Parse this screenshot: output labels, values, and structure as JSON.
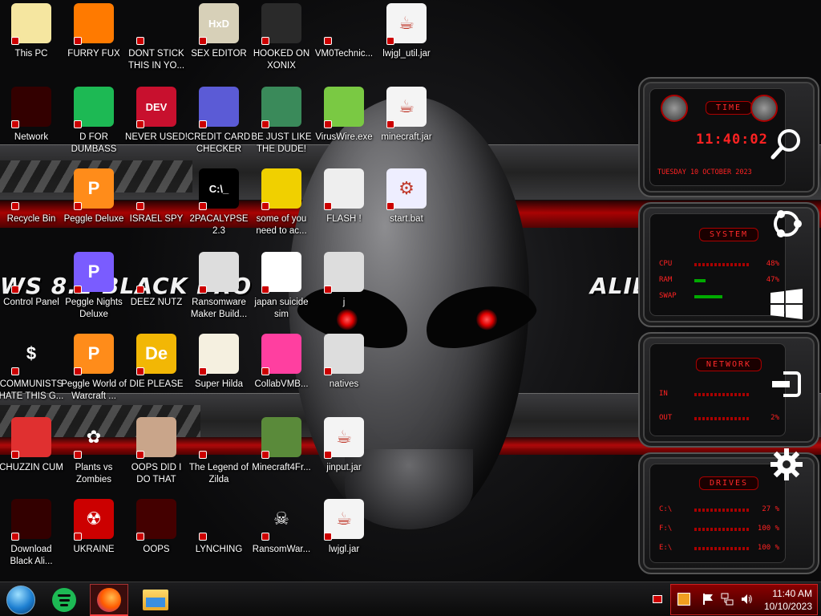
{
  "wallpaper": {
    "left_text": "WS 8.1 BLACK PRO",
    "right_text": "ALIE",
    "accent": "#e00000"
  },
  "desktop_icons": [
    {
      "label": "This PC",
      "icon": "anime-girl-icon",
      "bg": "#f5e6a0",
      "glyph": ""
    },
    {
      "label": "FURRY FUX",
      "icon": "firefox-icon",
      "bg": "#ff7a00",
      "glyph": ""
    },
    {
      "label": "DONT STICK THIS IN YO...",
      "icon": "vlc-cone-icon",
      "bg": "transparent",
      "glyph": ""
    },
    {
      "label": "SEX EDITOR",
      "icon": "hxd-icon",
      "bg": "#d7d0b8",
      "glyph": "HxD"
    },
    {
      "label": "HOOKED ON XONIX",
      "icon": "xonix-icon",
      "bg": "#2a2a2a",
      "glyph": ""
    },
    {
      "label": "VM0Technic...",
      "icon": "doctor-icon",
      "bg": "transparent",
      "glyph": ""
    },
    {
      "label": "lwjgl_util.jar",
      "icon": "java-jar-icon",
      "bg": "#f4f4f4",
      "glyph": "☕"
    },
    {
      "label": "Network",
      "icon": "alien-globe-icon",
      "bg": "#300",
      "glyph": ""
    },
    {
      "label": "D FOR DUMBASS",
      "icon": "spotify-icon",
      "bg": "#1db954",
      "glyph": ""
    },
    {
      "label": "NEVER USED!",
      "icon": "devcpp-icon",
      "bg": "#c8102e",
      "glyph": "DEV"
    },
    {
      "label": "CREDIT CARD CHECKER",
      "icon": "credit-card-icon",
      "bg": "#5b5bd6",
      "glyph": ""
    },
    {
      "label": "BE JUST LIKE THE DUDE!",
      "icon": "santa-elf-icon",
      "bg": "#3a8a5a",
      "glyph": ""
    },
    {
      "label": "VirusWire.exe",
      "icon": "limewire-icon",
      "bg": "#7ac943",
      "glyph": ""
    },
    {
      "label": "minecraft.jar",
      "icon": "java-jar-icon",
      "bg": "#f4f4f4",
      "glyph": "☕"
    },
    {
      "label": "Recycle Bin",
      "icon": "recycle-bin-icon",
      "bg": "transparent",
      "glyph": ""
    },
    {
      "label": "Peggle Deluxe",
      "icon": "peggle-icon",
      "bg": "#ff8c1a",
      "glyph": "P"
    },
    {
      "label": "ISRAEL SPY",
      "icon": "network-spy-icon",
      "bg": "transparent",
      "glyph": ""
    },
    {
      "label": "2PACALYPSE 2.3",
      "icon": "cmd-icon",
      "bg": "#000",
      "glyph": "C:\\_"
    },
    {
      "label": "some of you need to ac...",
      "icon": "dog-icon",
      "bg": "#f0d000",
      "glyph": ""
    },
    {
      "label": "FLASH !",
      "icon": "flash-file-icon",
      "bg": "#eee",
      "glyph": ""
    },
    {
      "label": "start.bat",
      "icon": "batch-gear-icon",
      "bg": "#eef",
      "glyph": "⚙"
    },
    {
      "label": "Control Panel",
      "icon": "control-panel-icon",
      "bg": "transparent",
      "glyph": ""
    },
    {
      "label": "Peggle Nights Deluxe",
      "icon": "peggle-nights-icon",
      "bg": "#7a5cff",
      "glyph": "P"
    },
    {
      "label": "DEEZ NUTZ",
      "icon": "windows-stack-icon",
      "bg": "transparent",
      "glyph": ""
    },
    {
      "label": "Ransomware Maker Build...",
      "icon": "app-window-icon",
      "bg": "#ddd",
      "glyph": ""
    },
    {
      "label": "japan suicide sim",
      "icon": "game-file-icon",
      "bg": "#fff",
      "glyph": ""
    },
    {
      "label": "j",
      "icon": "blank-file-icon",
      "bg": "#ddd",
      "glyph": ""
    },
    {
      "label": "COMMUNISTS HATE THIS G...",
      "icon": "money-bag-icon",
      "bg": "transparent",
      "glyph": "$"
    },
    {
      "label": "Peggle World of Warcraft ...",
      "icon": "peggle-wow-icon",
      "bg": "#ff8c1a",
      "glyph": "P"
    },
    {
      "label": "DIE PLEASE",
      "icon": "die-icon",
      "bg": "#f2b705",
      "glyph": "De"
    },
    {
      "label": "Super Hilda",
      "icon": "pixel-dog-icon",
      "bg": "#f5f0e0",
      "glyph": ""
    },
    {
      "label": "CollabVMB...",
      "icon": "pink-cube-icon",
      "bg": "#ff3fa0",
      "glyph": ""
    },
    {
      "label": "natives",
      "icon": "blank-file-icon",
      "bg": "#ddd",
      "glyph": ""
    },
    {
      "label": "CHUZZIN CUM",
      "icon": "chuzzle-icon",
      "bg": "#e03030",
      "glyph": ""
    },
    {
      "label": "Plants vs Zombies",
      "icon": "pvz-flower-icon",
      "bg": "transparent",
      "glyph": "✿"
    },
    {
      "label": "OOPS DID I DO THAT",
      "icon": "portrait-icon",
      "bg": "#c9a58a",
      "glyph": ""
    },
    {
      "label": "The Legend of Zilda",
      "icon": "zelda-icon",
      "bg": "transparent",
      "glyph": ""
    },
    {
      "label": "Minecraft4Fr...",
      "icon": "minecraft-block-icon",
      "bg": "#5a8a3a",
      "glyph": ""
    },
    {
      "label": "jinput.jar",
      "icon": "java-jar-icon",
      "bg": "#f4f4f4",
      "glyph": "☕"
    },
    {
      "label": "Download Black Ali...",
      "icon": "alien-globe-icon",
      "bg": "#300",
      "glyph": ""
    },
    {
      "label": "UKRAINE",
      "icon": "radiation-icon",
      "bg": "#c00",
      "glyph": "☢"
    },
    {
      "label": "OOPS",
      "icon": "red-book-icon",
      "bg": "#400",
      "glyph": ""
    },
    {
      "label": "LYNCHING",
      "icon": "noose-icon",
      "bg": "transparent",
      "glyph": ""
    },
    {
      "label": "RansomWar...",
      "icon": "skull-icon",
      "bg": "transparent",
      "glyph": "☠"
    },
    {
      "label": "lwjgl.jar",
      "icon": "java-jar-icon",
      "bg": "#f4f4f4",
      "glyph": "☕"
    }
  ],
  "gadgets": {
    "time": {
      "title": "TIME",
      "clock": "11:40:02",
      "date": "TUESDAY 10 OCTOBER 2023"
    },
    "system": {
      "title": "SYSTEM",
      "rows": [
        {
          "label": "CPU",
          "value": "48%"
        },
        {
          "label": "RAM",
          "value": "47%"
        },
        {
          "label": "SWAP",
          "value": ""
        }
      ]
    },
    "network": {
      "title": "NETWORK",
      "rows": [
        {
          "label": "IN",
          "value": ""
        },
        {
          "label": "OUT",
          "value": "2%"
        }
      ]
    },
    "drives": {
      "title": "DRIVES",
      "rows": [
        {
          "label": "C:\\",
          "value": "27 %"
        },
        {
          "label": "F:\\",
          "value": "100 %"
        },
        {
          "label": "E:\\",
          "value": "100 %"
        }
      ]
    }
  },
  "sidebar_icons": [
    "search-icon",
    "ubuntu-icon",
    "windows-logo-icon",
    "sign-out-icon",
    "gear-icon"
  ],
  "taskbar": {
    "apps": [
      {
        "name": "start-orb-icon"
      },
      {
        "name": "spotify-icon"
      },
      {
        "name": "firefox-icon",
        "active": true
      },
      {
        "name": "file-explorer-icon"
      }
    ],
    "clock_time": "11:40 AM",
    "clock_date": "10/10/2023"
  }
}
